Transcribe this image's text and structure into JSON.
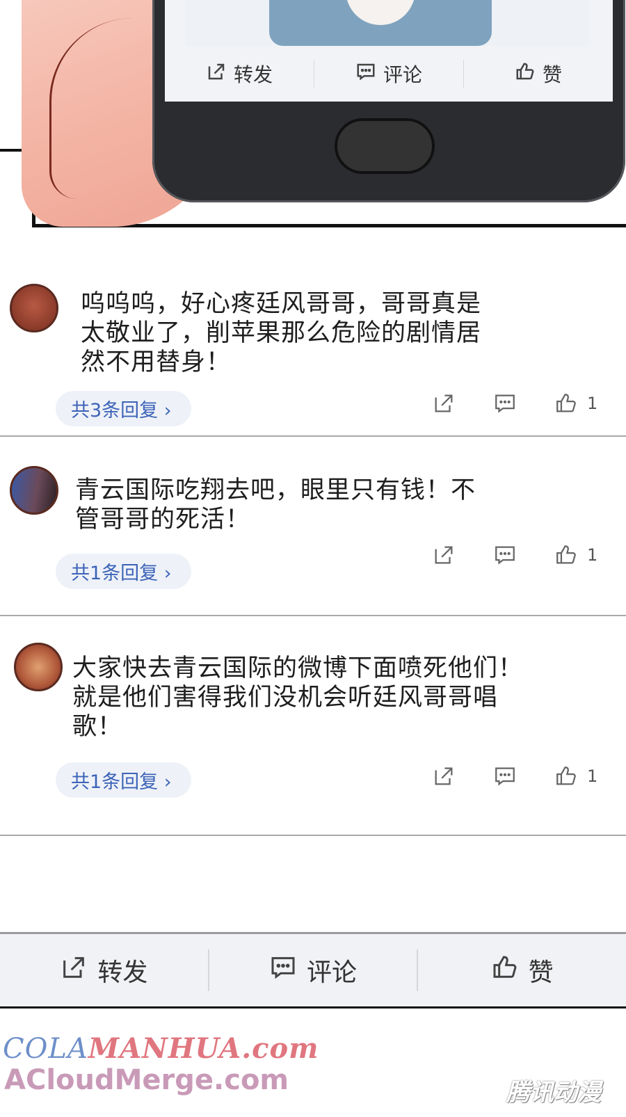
{
  "phone": {
    "actions": {
      "repost_label": "转发",
      "comment_label": "评论",
      "like_label": "赞"
    }
  },
  "comments": [
    {
      "lines": [
        "呜呜呜，好心疼廷风哥哥，哥哥真是",
        "太敬业了，削苹果那么危险的剧情居",
        "然不用替身！"
      ],
      "reply_label": "共3条回复",
      "like_count": "1"
    },
    {
      "lines": [
        "青云国际吃翔去吧，眼里只有钱！不",
        "管哥哥的死活！"
      ],
      "reply_label": "共1条回复",
      "like_count": "1"
    },
    {
      "lines": [
        "大家快去青云国际的微博下面喷死他们！",
        "就是他们害得我们没机会听廷风哥哥唱",
        "歌！"
      ],
      "reply_label": "共1条回复",
      "like_count": "1"
    }
  ],
  "bottom_bar": {
    "repost_label": "转发",
    "comment_label": "评论",
    "like_label": "赞"
  },
  "watermarks": {
    "line1_a": "COLA",
    "line1_b": "MANHUA.com",
    "line2": "ACloudMerge.com",
    "corner": "腾讯动漫"
  },
  "colors": {
    "reply_link": "#3d63b8",
    "bar_background": "#f1f2f5",
    "phone_body": "#2b2c30"
  }
}
